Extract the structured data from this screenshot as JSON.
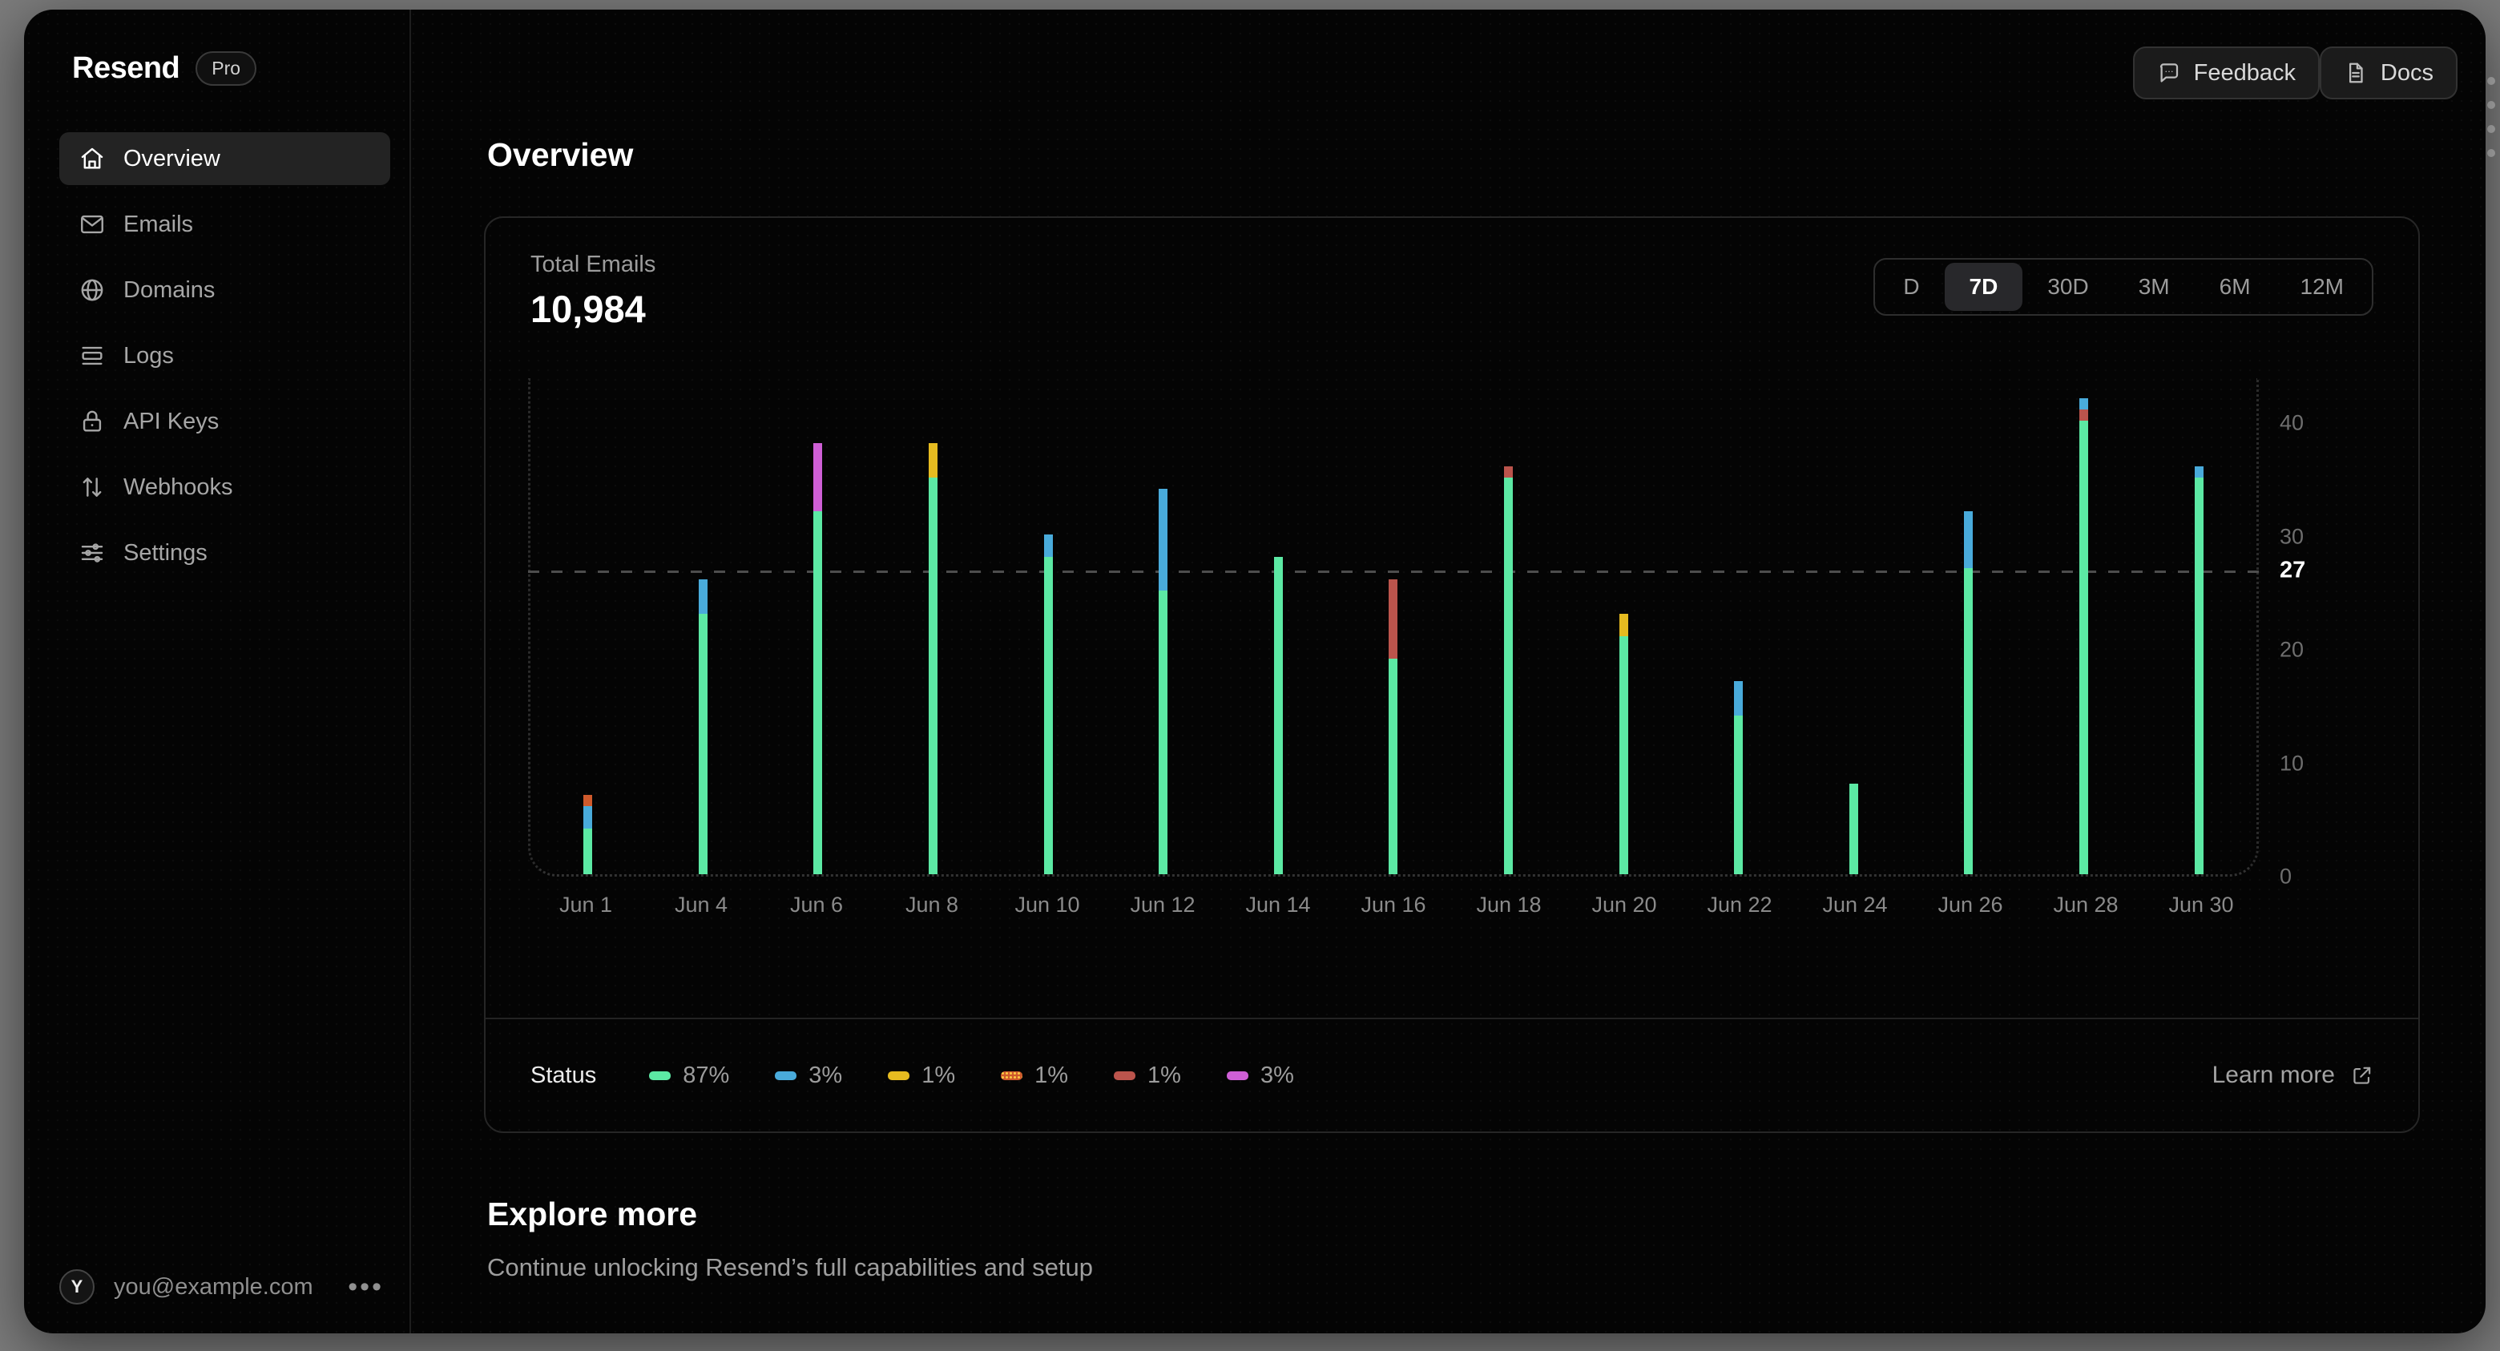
{
  "app": {
    "name": "Resend",
    "plan_badge": "Pro"
  },
  "sidebar": {
    "items": [
      {
        "label": "Overview",
        "icon": "home-icon",
        "active": true
      },
      {
        "label": "Emails",
        "icon": "mail-icon",
        "active": false
      },
      {
        "label": "Domains",
        "icon": "globe-icon",
        "active": false
      },
      {
        "label": "Logs",
        "icon": "logs-icon",
        "active": false
      },
      {
        "label": "API Keys",
        "icon": "lock-icon",
        "active": false
      },
      {
        "label": "Webhooks",
        "icon": "webhooks-icon",
        "active": false
      },
      {
        "label": "Settings",
        "icon": "settings-icon",
        "active": false
      }
    ],
    "user": {
      "avatar_initial": "Y",
      "email": "you@example.com",
      "menu_icon": "ellipsis-icon"
    }
  },
  "header": {
    "feedback_label": "Feedback",
    "docs_label": "Docs"
  },
  "page": {
    "title": "Overview"
  },
  "stats_card": {
    "metric_label": "Total Emails",
    "metric_value": "10,984",
    "ranges": [
      {
        "label": "D",
        "selected": false
      },
      {
        "label": "7D",
        "selected": true
      },
      {
        "label": "30D",
        "selected": false
      },
      {
        "label": "3M",
        "selected": false
      },
      {
        "label": "6M",
        "selected": false
      },
      {
        "label": "12M",
        "selected": false
      }
    ],
    "learn_more_label": "Learn more"
  },
  "chart_data": {
    "type": "bar",
    "stacked": true,
    "title": "Total Emails",
    "categories": [
      "Jun 1",
      "Jun 4",
      "Jun 6",
      "Jun 8",
      "Jun 10",
      "Jun 12",
      "Jun 14",
      "Jun 16",
      "Jun 18",
      "Jun 20",
      "Jun 22",
      "Jun 24",
      "Jun 26",
      "Jun 28",
      "Jun 30"
    ],
    "bars": [
      {
        "category": "Jun 1",
        "total": 7,
        "segments": [
          {
            "status": "green",
            "value": 4
          },
          {
            "status": "blue",
            "value": 2
          },
          {
            "status": "orange",
            "value": 1
          }
        ]
      },
      {
        "category": "Jun 4",
        "total": 26,
        "segments": [
          {
            "status": "green",
            "value": 23
          },
          {
            "status": "blue",
            "value": 3
          }
        ]
      },
      {
        "category": "Jun 6",
        "total": 38,
        "segments": [
          {
            "status": "green",
            "value": 32
          },
          {
            "status": "magenta",
            "value": 6
          }
        ]
      },
      {
        "category": "Jun 8",
        "total": 38,
        "segments": [
          {
            "status": "green",
            "value": 35
          },
          {
            "status": "yellow",
            "value": 3
          }
        ]
      },
      {
        "category": "Jun 10",
        "total": 30,
        "segments": [
          {
            "status": "green",
            "value": 28
          },
          {
            "status": "blue",
            "value": 2
          }
        ]
      },
      {
        "category": "Jun 12",
        "total": 34,
        "segments": [
          {
            "status": "green",
            "value": 25
          },
          {
            "status": "blue",
            "value": 9
          }
        ]
      },
      {
        "category": "Jun 14",
        "total": 28,
        "segments": [
          {
            "status": "green",
            "value": 28
          }
        ]
      },
      {
        "category": "Jun 16",
        "total": 26,
        "segments": [
          {
            "status": "green",
            "value": 19
          },
          {
            "status": "red",
            "value": 7
          }
        ]
      },
      {
        "category": "Jun 18",
        "total": 36,
        "segments": [
          {
            "status": "green",
            "value": 35
          },
          {
            "status": "red",
            "value": 1
          }
        ]
      },
      {
        "category": "Jun 20",
        "total": 23,
        "segments": [
          {
            "status": "green",
            "value": 21
          },
          {
            "status": "yellow",
            "value": 2
          }
        ]
      },
      {
        "category": "Jun 22",
        "total": 17,
        "segments": [
          {
            "status": "green",
            "value": 14
          },
          {
            "status": "blue",
            "value": 3
          }
        ]
      },
      {
        "category": "Jun 24",
        "total": 8,
        "segments": [
          {
            "status": "green",
            "value": 8
          }
        ]
      },
      {
        "category": "Jun 26",
        "total": 32,
        "segments": [
          {
            "status": "green",
            "value": 27
          },
          {
            "status": "blue",
            "value": 5
          }
        ]
      },
      {
        "category": "Jun 28",
        "total": 42,
        "segments": [
          {
            "status": "green",
            "value": 40
          },
          {
            "status": "red",
            "value": 1
          },
          {
            "status": "blue",
            "value": 1
          }
        ]
      },
      {
        "category": "Jun 30",
        "total": 36,
        "segments": [
          {
            "status": "green",
            "value": 35
          },
          {
            "status": "blue",
            "value": 1
          }
        ]
      }
    ],
    "y_ticks": [
      0,
      10,
      20,
      30,
      40
    ],
    "average_line": {
      "value": 27
    },
    "ylim": [
      0,
      44
    ],
    "grid": "off",
    "legend_position": "bottom",
    "colors": {
      "green": "#5ce9a4",
      "blue": "#49abdb",
      "yellow": "#e6bb20",
      "orange": "#cf5a2c",
      "red": "#bb544c",
      "magenta": "#cf5fd6"
    },
    "legend": {
      "label": "Status",
      "items": [
        {
          "status": "green",
          "pct": "87%"
        },
        {
          "status": "blue",
          "pct": "3%"
        },
        {
          "status": "yellow",
          "pct": "1%"
        },
        {
          "status": "orange",
          "pct": "1%"
        },
        {
          "status": "red",
          "pct": "1%"
        },
        {
          "status": "magenta",
          "pct": "3%"
        }
      ]
    }
  },
  "explore": {
    "title": "Explore more",
    "subtitle": "Continue unlocking Resend’s full capabilities and setup"
  }
}
